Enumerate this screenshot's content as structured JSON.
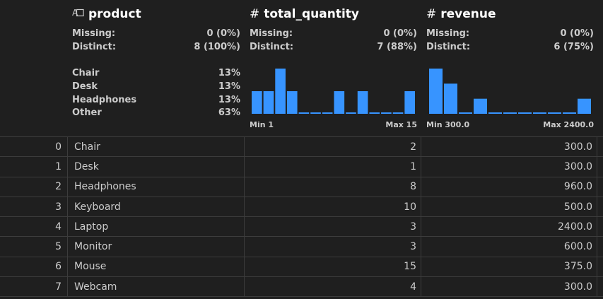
{
  "columns": [
    {
      "name": "product",
      "type_icon": "text-type-icon",
      "missing_label": "Missing:",
      "missing_value": "0 (0%)",
      "distinct_label": "Distinct:",
      "distinct_value": "8 (100%)",
      "frequencies": [
        {
          "label": "Chair",
          "value": "13%"
        },
        {
          "label": "Desk",
          "value": "13%"
        },
        {
          "label": "Headphones",
          "value": "13%"
        },
        {
          "label": "Other",
          "value": "63%"
        }
      ]
    },
    {
      "name": "total_quantity",
      "type_icon": "hash-icon",
      "missing_label": "Missing:",
      "missing_value": "0 (0%)",
      "distinct_label": "Distinct:",
      "distinct_value": "7 (88%)",
      "hist_counts": [
        1,
        1,
        2,
        1,
        0,
        0,
        0,
        1,
        0,
        1,
        0,
        0,
        0,
        1
      ],
      "hist_min": "Min 1",
      "hist_max": "Max 15"
    },
    {
      "name": "revenue",
      "type_icon": "hash-icon",
      "missing_label": "Missing:",
      "missing_value": "0 (0%)",
      "distinct_label": "Distinct:",
      "distinct_value": "6 (75%)",
      "hist_counts": [
        3,
        2,
        0,
        1,
        0,
        0,
        0,
        0,
        0,
        0,
        1
      ],
      "hist_min": "Min 300.0",
      "hist_max": "Max 2400.0"
    }
  ],
  "rows": [
    {
      "idx": "0",
      "product": "Chair",
      "total_quantity": "2",
      "revenue": "300.0"
    },
    {
      "idx": "1",
      "product": "Desk",
      "total_quantity": "1",
      "revenue": "300.0"
    },
    {
      "idx": "2",
      "product": "Headphones",
      "total_quantity": "8",
      "revenue": "960.0"
    },
    {
      "idx": "3",
      "product": "Keyboard",
      "total_quantity": "10",
      "revenue": "500.0"
    },
    {
      "idx": "4",
      "product": "Laptop",
      "total_quantity": "3",
      "revenue": "2400.0"
    },
    {
      "idx": "5",
      "product": "Monitor",
      "total_quantity": "3",
      "revenue": "600.0"
    },
    {
      "idx": "6",
      "product": "Mouse",
      "total_quantity": "15",
      "revenue": "375.0"
    },
    {
      "idx": "7",
      "product": "Webcam",
      "total_quantity": "4",
      "revenue": "300.0"
    }
  ],
  "colors": {
    "bar": "#3794ff",
    "background": "#1f1f1f"
  }
}
